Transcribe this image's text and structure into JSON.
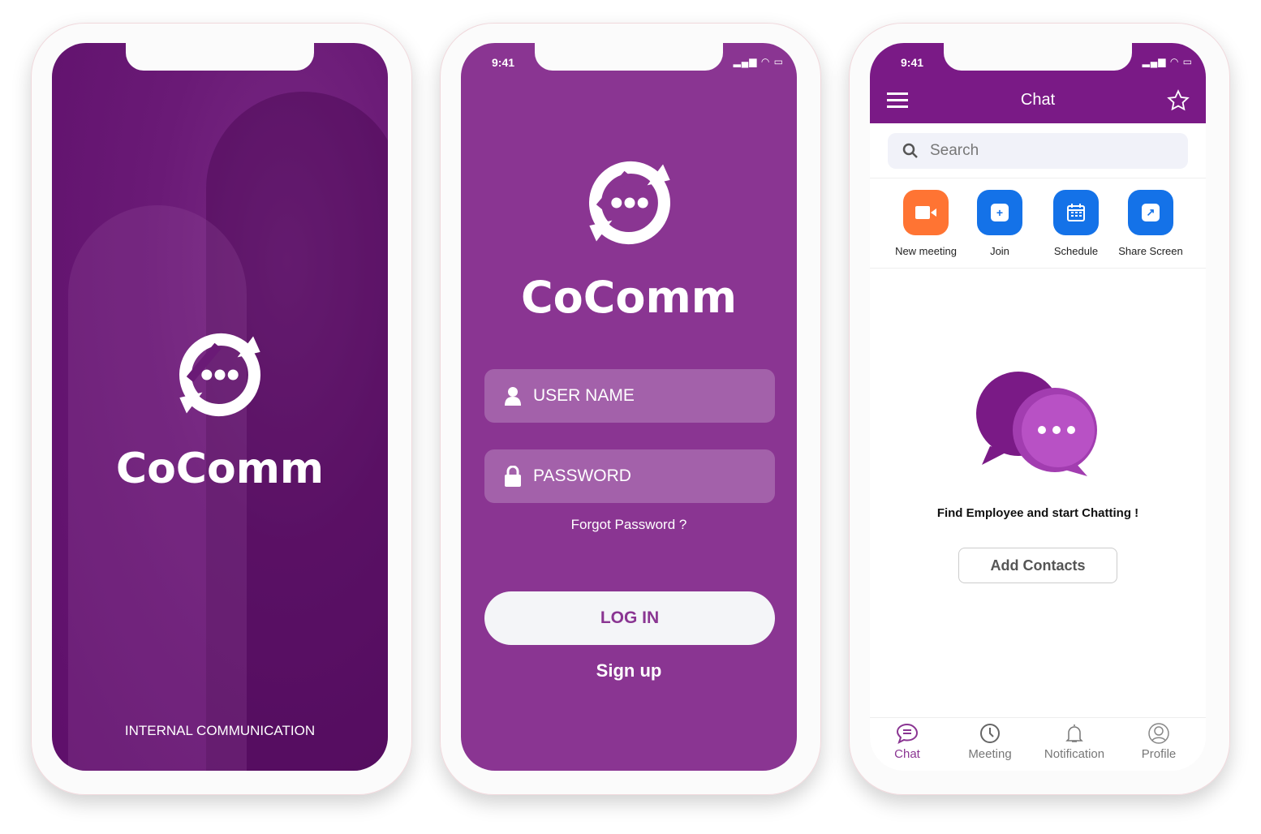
{
  "splash": {
    "brand": "CoComm",
    "tagline": "INTERNAL COMMUNICATION"
  },
  "login": {
    "time": "9:41",
    "brand": "CoComm",
    "username_placeholder": "USER NAME",
    "password_placeholder": "PASSWORD",
    "forgot": "Forgot Password ?",
    "login_label": "LOG IN",
    "signup_label": "Sign up"
  },
  "chat": {
    "time": "9:41",
    "title": "Chat",
    "search_placeholder": "Search",
    "actions": [
      {
        "label": "New meeting",
        "color": "#ff7433",
        "icon": "video-icon"
      },
      {
        "label": "Join",
        "color": "#1472e8",
        "icon": "plus-icon"
      },
      {
        "label": "Schedule",
        "color": "#1472e8",
        "icon": "calendar-icon"
      },
      {
        "label": "Share Screen",
        "color": "#1472e8",
        "icon": "share-arrow-icon"
      }
    ],
    "empty_text": "Find Employee and start Chatting !",
    "add_contacts": "Add Contacts",
    "nav": [
      {
        "label": "Chat",
        "active": true
      },
      {
        "label": "Meeting"
      },
      {
        "label": "Notification"
      },
      {
        "label": "Profile"
      }
    ],
    "accent": "#7a1a86"
  }
}
